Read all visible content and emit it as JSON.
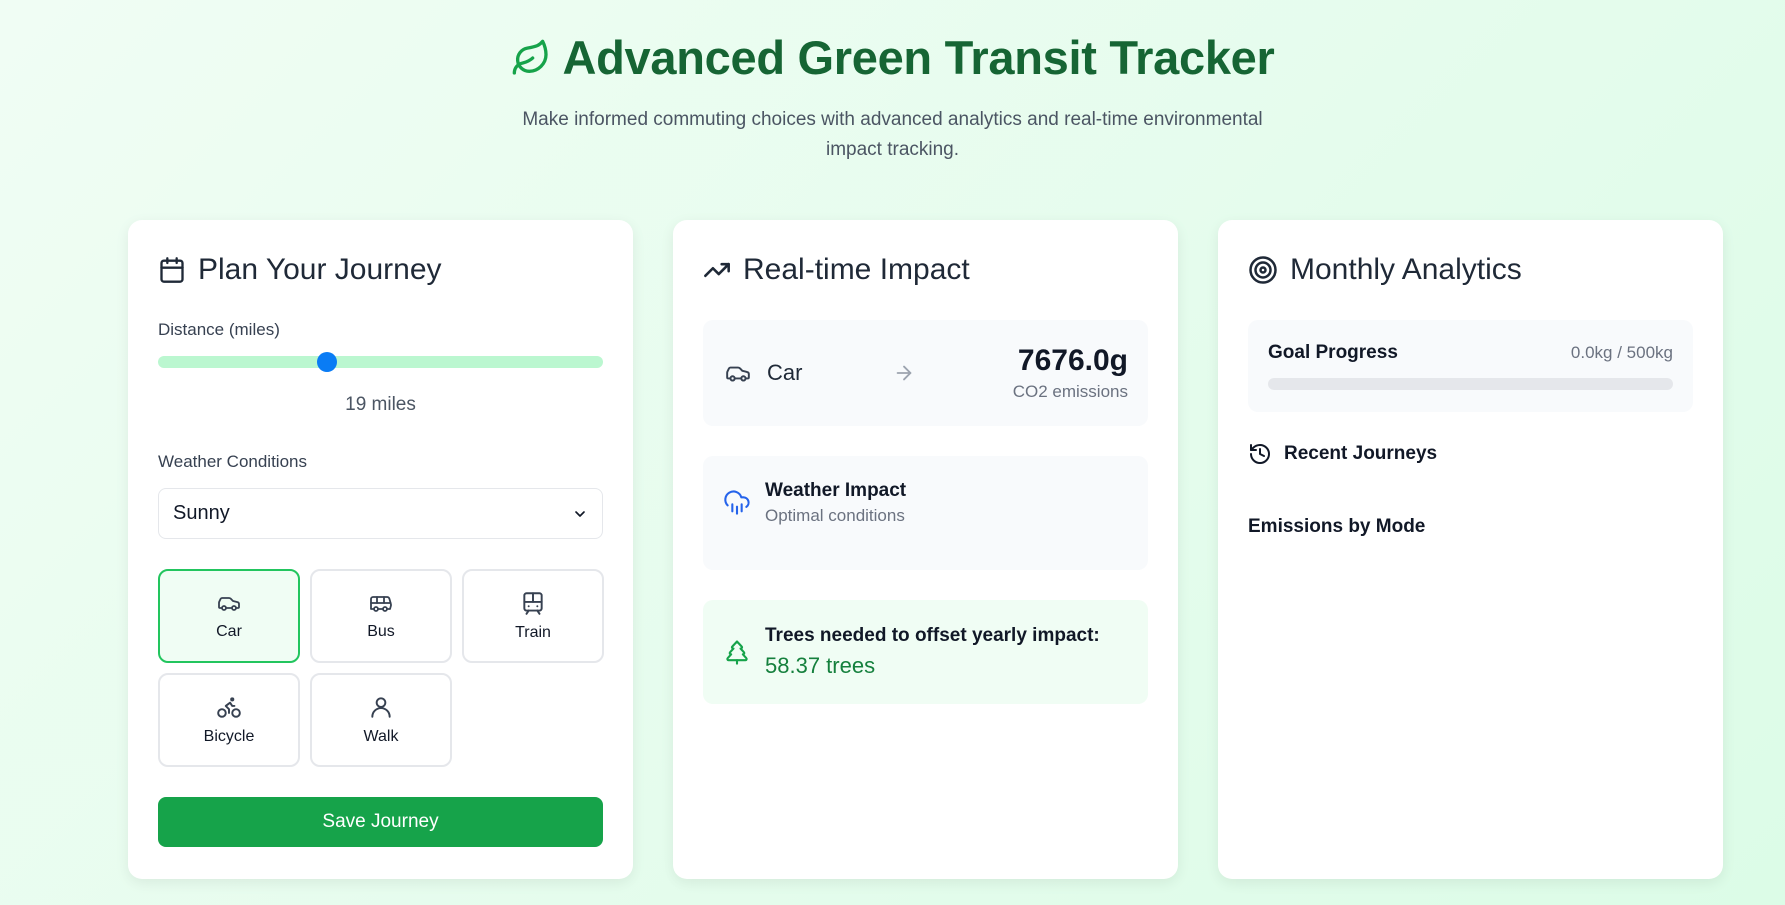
{
  "header": {
    "title": "Advanced Green Transit Tracker",
    "subtitle": "Make informed commuting choices with advanced analytics and real-time environmental impact tracking."
  },
  "journey": {
    "title": "Plan Your Journey",
    "distance_label": "Distance (miles)",
    "distance_value": "19 miles",
    "distance_fraction": 0.38,
    "weather_label": "Weather Conditions",
    "weather_selected": "Sunny",
    "modes": [
      {
        "label": "Car",
        "icon": "car-icon",
        "active": true
      },
      {
        "label": "Bus",
        "icon": "bus-icon",
        "active": false
      },
      {
        "label": "Train",
        "icon": "train-icon",
        "active": false
      },
      {
        "label": "Bicycle",
        "icon": "bicycle-icon",
        "active": false
      },
      {
        "label": "Walk",
        "icon": "walk-icon",
        "active": false
      }
    ],
    "save_label": "Save Journey"
  },
  "impact": {
    "title": "Real-time Impact",
    "mode": "Car",
    "co2_value": "7676.0g",
    "co2_unit": "CO2 emissions",
    "weather_title": "Weather Impact",
    "weather_sub": "Optimal conditions",
    "trees_title": "Trees needed to offset yearly impact:",
    "trees_value": "58.37 trees"
  },
  "analytics": {
    "title": "Monthly Analytics",
    "goal_label": "Goal Progress",
    "goal_value": "0.0kg / 500kg",
    "goal_fraction": 0,
    "recent_label": "Recent Journeys",
    "emissions_label": "Emissions by Mode"
  },
  "colors": {
    "brand": "#166534",
    "accent": "#16a34a",
    "slider_thumb": "#0a7cf5"
  }
}
